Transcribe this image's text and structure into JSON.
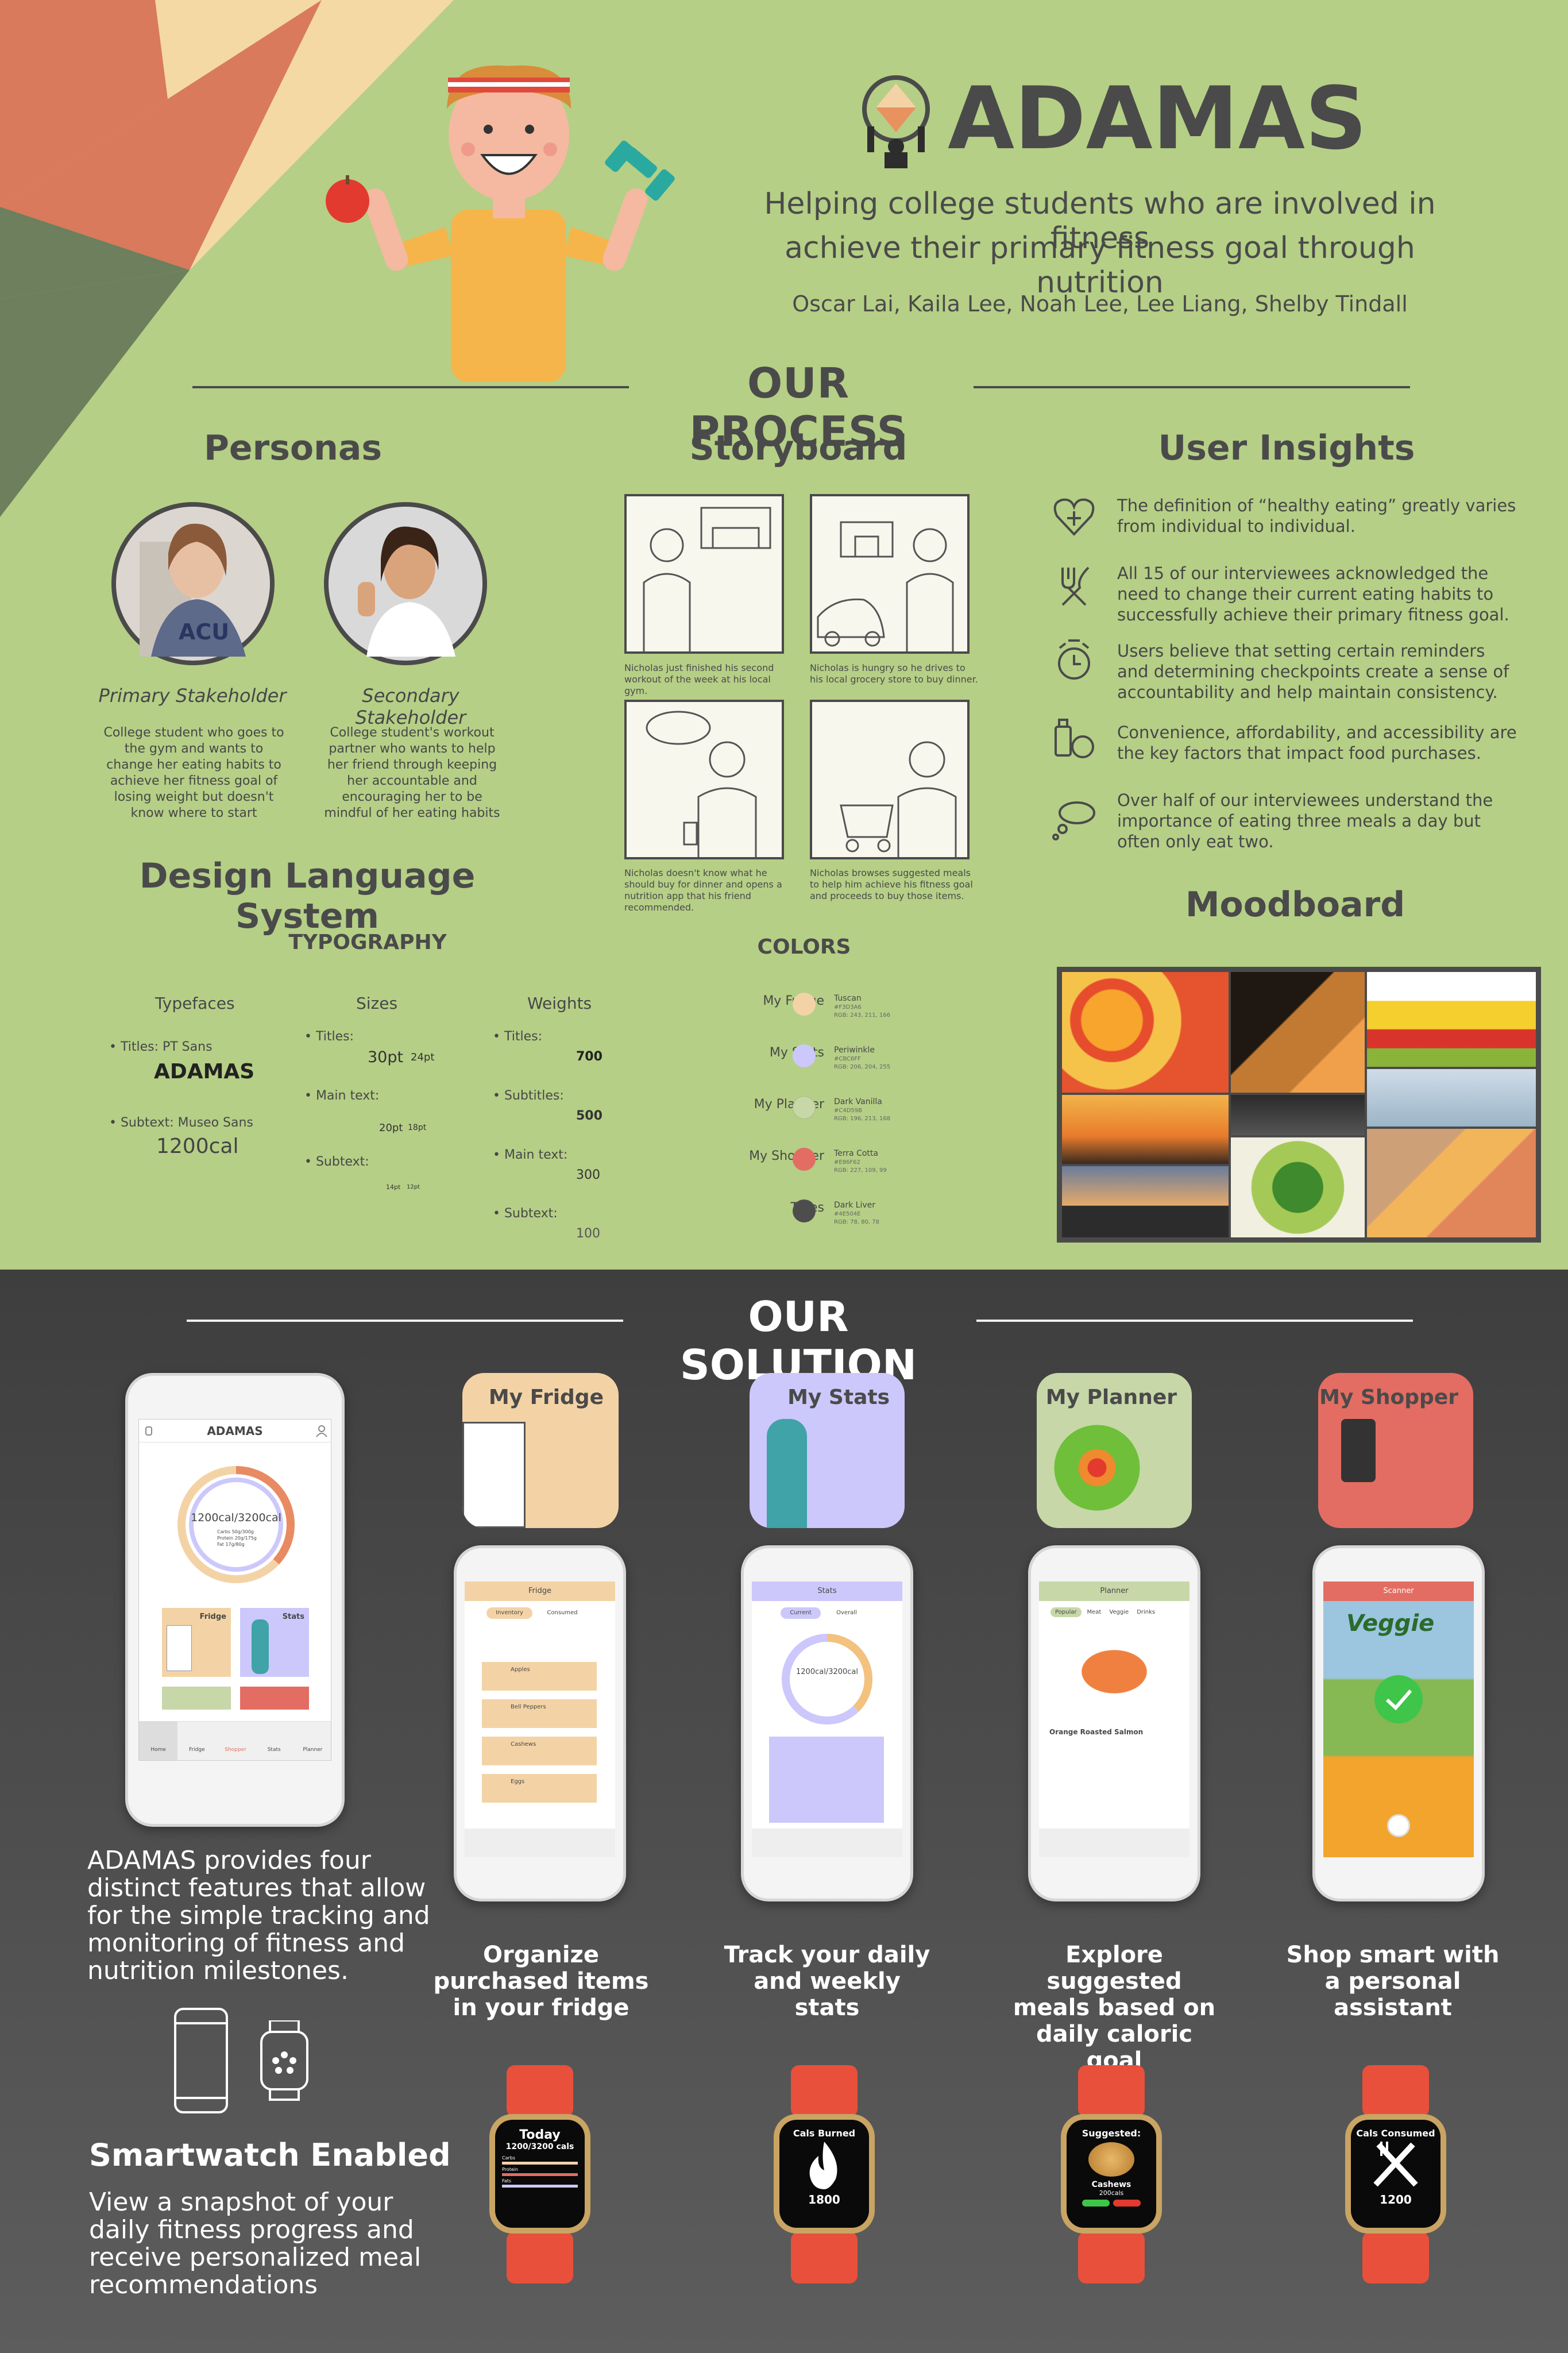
{
  "header": {
    "brand": "ADAMAS",
    "tagline_1": "Helping college students who are involved in fitness",
    "tagline_2": "achieve their primary fitness goal through nutrition",
    "authors": "Oscar Lai, Kaila Lee, Noah Lee, Lee Liang, Shelby Tindall"
  },
  "process": {
    "title": "OUR PROCESS",
    "personas": {
      "title": "Personas",
      "primary_label": "Primary Stakeholder",
      "primary_desc": "College student who goes to the gym and wants to change her eating habits to achieve her fitness goal of losing weight but doesn't know where to start",
      "secondary_label": "Secondary Stakeholder",
      "secondary_desc": "College student's workout partner who wants to help her friend through keeping her accountable and encouraging her to be mindful of her eating habits"
    },
    "storyboard": {
      "title": "Storyboard",
      "caption_1": "Nicholas just finished his second workout of the week at his local gym.",
      "caption_2": "Nicholas is hungry so he drives to his local grocery store to buy dinner.",
      "caption_3": "Nicholas doesn't know what he should buy for dinner and opens a nutrition app that his friend recommended.",
      "caption_4": "Nicholas browses suggested meals to help him achieve his fitness goal and proceeds to buy those items."
    },
    "insights": {
      "title": "User Insights",
      "items": [
        "The definition of “healthy eating” greatly varies from individual to individual.",
        "All 15 of our interviewees acknowledged the need to change their current eating habits to successfully achieve their primary fitness goal.",
        "Users believe that setting certain reminders and determining checkpoints create a sense of accountability and help maintain consistency.",
        "Convenience, affordability, and accessibility are the key factors that impact food purchases.",
        "Over half of our interviewees understand the importance of eating three meals a day but often only eat two."
      ]
    },
    "design": {
      "title": "Design Language System",
      "typography": "TYPOGRAPHY",
      "typefaces": "Typefaces",
      "sizes": "Sizes",
      "weights": "Weights",
      "titles_font": "• Titles: PT Sans",
      "sample_title": "ADAMAS",
      "subtext_font": "• Subtext: Museo Sans",
      "sample_sub": "1200cal",
      "s_titles": "• Titles:",
      "s_titles_v1": "30pt",
      "s_titles_v2": "24pt",
      "s_main": "• Main text:",
      "s_main_v1": "20pt",
      "s_main_v2": "18pt",
      "s_sub": "• Subtext:",
      "s_sub_v1": "14pt",
      "s_sub_v2": "12pt",
      "w_titles": "• Titles:",
      "w_titles_v": "700",
      "w_subtitles": "• Subtitles:",
      "w_subtitles_v": "500",
      "w_main": "• Main text:",
      "w_main_v": "300",
      "w_sub": "• Subtext:",
      "w_sub_v": "100"
    },
    "colors": {
      "title": "COLORS",
      "items": [
        {
          "use": "My Fridge",
          "name": "Tuscan",
          "hex": "#F3D3A6",
          "rgb": "RGB: 243, 211, 166",
          "swatch": "#f3d3a6"
        },
        {
          "use": "My Stats",
          "name": "Periwinkle",
          "hex": "#CBC6FF",
          "rgb": "RGB: 206, 204, 255",
          "swatch": "#ccc8fb"
        },
        {
          "use": "My Planner",
          "name": "Dark Vanilla",
          "hex": "#C4D59B",
          "rgb": "RGB: 196, 213, 168",
          "swatch": "#c7d7a8"
        },
        {
          "use": "My Shopper",
          "name": "Terra Cotta",
          "hex": "#E86F62",
          "rgb": "RGB: 227, 109, 99",
          "swatch": "#e36d63"
        },
        {
          "use": "Titles",
          "name": "Dark Liver",
          "hex": "#4E504E",
          "rgb": "RGB: 78, 80, 78",
          "swatch": "#4d4d4d"
        }
      ]
    },
    "moodboard": {
      "title": "Moodboard"
    }
  },
  "solution": {
    "title": "OUR SOLUTION",
    "main_phone": {
      "app_title": "ADAMAS",
      "ring_text": "1200cal/3200cal",
      "legend": [
        "Carbs 50g/300g",
        "Protein 20g/175g",
        "Fat 17g/80g"
      ],
      "tile_fridge": "Fridge",
      "tile_stats": "Stats",
      "nav": [
        "Home",
        "Fridge",
        "Shopper",
        "Stats",
        "Planner"
      ]
    },
    "description": "ADAMAS provides four distinct features that allow for the simple tracking and monitoring of fitness and nutrition milestones.",
    "smartwatch_title": "Smartwatch Enabled",
    "smartwatch_desc": "View a snapshot of  your daily fitness progress and receive personalized meal recommendations",
    "features": [
      {
        "card_title": "My Fridge",
        "screen_title": "Fridge",
        "tab_1": "Inventory",
        "tab_2": "Consumed",
        "rows": [
          "Apples",
          "Bell Peppers",
          "Cashews",
          "Eggs"
        ],
        "caption": "Organize purchased items in your fridge",
        "watch_title": "Today",
        "watch_value": "1200/3200 cals",
        "watch_rows": [
          "Carbs",
          "Protein",
          "Fats"
        ]
      },
      {
        "card_title": "My Stats",
        "screen_title": "Stats",
        "tab_1": "Current",
        "tab_2": "Overall",
        "ring_text": "1200cal/3200cal",
        "caption": "Track your daily and weekly stats",
        "watch_title": "Cals Burned",
        "watch_value": "1800"
      },
      {
        "card_title": "My Planner",
        "screen_title": "Planner",
        "tabs": [
          "Popular",
          "Meat",
          "Veggie",
          "Drinks"
        ],
        "meal": "Orange Roasted Salmon",
        "caption": "Explore suggested meals based on daily caloric goal",
        "watch_title": "Suggested:",
        "watch_food": "Cashews",
        "watch_value": "200cals"
      },
      {
        "card_title": "My Shopper",
        "screen_title": "Scanner",
        "product": "Veggie",
        "caption": "Shop smart with a personal assistant",
        "watch_title": "Cals Consumed",
        "watch_value": "1200"
      }
    ]
  },
  "palette": {
    "bg_green": "#b5cf86",
    "dark_liver": "#4a4a4a",
    "tuscan": "#f3d3a6",
    "periwinkle": "#ccc8fb",
    "dark_vanilla": "#c7d7a8",
    "terra_cotta": "#e36d63"
  }
}
